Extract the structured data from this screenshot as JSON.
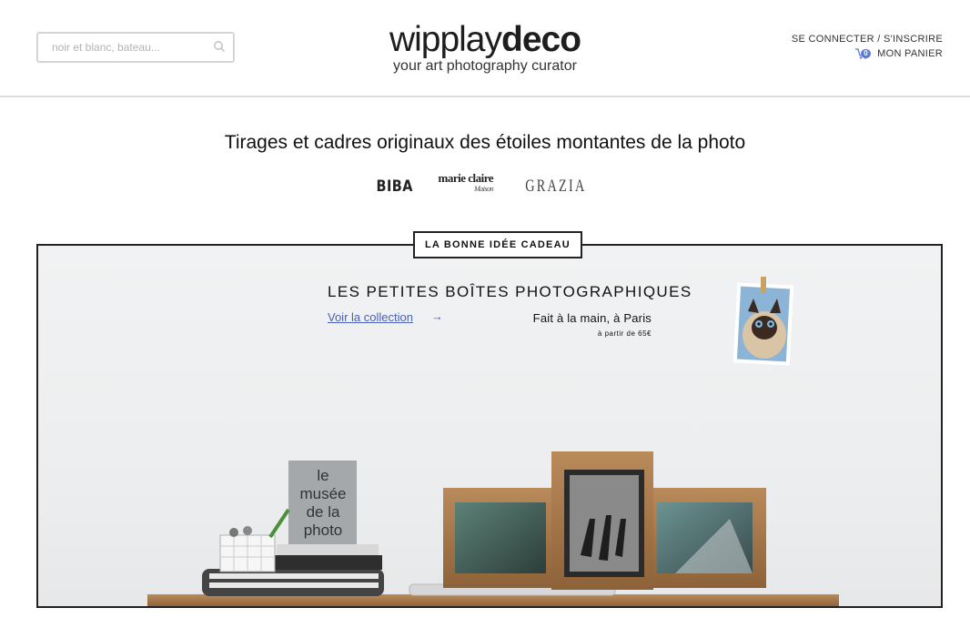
{
  "search": {
    "placeholder": "noir et blanc, bateau..."
  },
  "logo": {
    "main_regular": "wipplay",
    "main_bold": "deco",
    "subtitle": "your art photography curator"
  },
  "account": {
    "login": "SE CONNECTER / S'INSCRIRE",
    "cart_label": "MON PANIER",
    "cart_count": "0"
  },
  "tagline": "Tirages et cadres originaux des étoiles montantes de la photo",
  "press": {
    "biba": "BIBA",
    "marieclaire": "marie claire",
    "maison": "Maison",
    "grazia": "GRAZIA"
  },
  "banner": {
    "badge": "LA BONNE IDÉE CADEAU",
    "title": "LES PETITES BOÎTES PHOTOGRAPHIQUES",
    "link": "Voir la collection",
    "arrow": "→",
    "made": "Fait à la main, à Paris",
    "price": "à partir de 65€",
    "book_lines": [
      "le",
      "musée",
      "de la",
      "photo"
    ]
  },
  "colors": {
    "link": "#4a62b8",
    "cart_badge": "#5b7bd5",
    "border": "#222222"
  }
}
